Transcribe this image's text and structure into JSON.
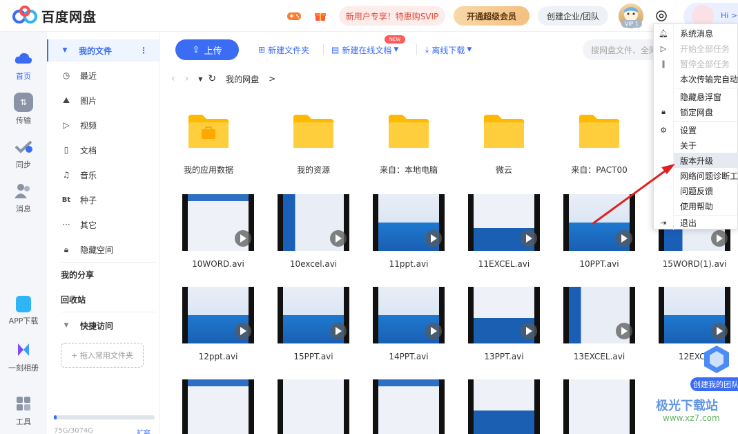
{
  "app": {
    "title": "百度网盘"
  },
  "header": {
    "promo": "新用户专享！特惠购SVIP",
    "svip_button": "开通超级会员",
    "team_button": "创建企业/团队",
    "vip_tag": "VIP 1",
    "hi": "Hi >"
  },
  "leftnav": [
    {
      "label": "首页",
      "icon": "cloud-icon"
    },
    {
      "label": "传输",
      "icon": "transfer-icon"
    },
    {
      "label": "同步",
      "icon": "sync-icon"
    },
    {
      "label": "消息",
      "icon": "message-icon"
    },
    {
      "label": "APP下载",
      "icon": "phone-icon"
    },
    {
      "label": "一刻相册",
      "icon": "album-icon"
    },
    {
      "label": "工具",
      "icon": "tools-icon"
    }
  ],
  "sidebar": {
    "my_files": "我的文件",
    "items": [
      {
        "label": "最近",
        "icon": "clock-icon"
      },
      {
        "label": "图片",
        "icon": "image-icon"
      },
      {
        "label": "视频",
        "icon": "video-icon"
      },
      {
        "label": "文档",
        "icon": "document-icon"
      },
      {
        "label": "音乐",
        "icon": "headphones-icon"
      },
      {
        "label": "种子",
        "icon": "bt-icon"
      },
      {
        "label": "其它",
        "icon": "more-icon"
      },
      {
        "label": "隐藏空间",
        "icon": "lock-icon"
      }
    ],
    "my_share": "我的分享",
    "recycle": "回收站",
    "quick_access": "快捷访问",
    "drop_hint": "+ 拖入常用文件夹",
    "quota": "75G/3074G",
    "expand": "扩容"
  },
  "toolbar": {
    "upload": "上传",
    "new_folder": "新建文件夹",
    "new_doc": "新建在线文档",
    "new_badge": "NEW",
    "offline": "离线下载",
    "search_placeholder": "搜网盘文件、全网"
  },
  "breadcrumb": {
    "root": "我的网盘",
    "sep": ">"
  },
  "folders": [
    {
      "name": "我的应用数据"
    },
    {
      "name": "我的资源"
    },
    {
      "name": "来自：本地电脑"
    },
    {
      "name": "微云"
    },
    {
      "name": "来自：PACT00"
    }
  ],
  "videos": [
    {
      "name": "10WORD.avi"
    },
    {
      "name": "10excel.avi"
    },
    {
      "name": "11ppt.avi"
    },
    {
      "name": "11EXCEL.avi"
    },
    {
      "name": "10PPT.avi"
    },
    {
      "name": "15WORD(1).avi"
    },
    {
      "name": "12ppt.avi"
    },
    {
      "name": "15PPT.avi"
    },
    {
      "name": "14PPT.avi"
    },
    {
      "name": "13PPT.avi"
    },
    {
      "name": "13EXCEL.avi"
    },
    {
      "name": "12EXCE"
    }
  ],
  "menu": {
    "items": [
      {
        "label": "系统消息"
      },
      {
        "label": "开始全部任务"
      },
      {
        "label": "暂停全部任务"
      },
      {
        "label": "本次传输完自动"
      },
      {
        "label": "隐藏悬浮窗"
      },
      {
        "label": "锁定网盘"
      },
      {
        "label": "设置"
      },
      {
        "label": "关于"
      },
      {
        "label": "版本升级"
      },
      {
        "label": "网络问题诊断工"
      },
      {
        "label": "问题反馈"
      },
      {
        "label": "使用帮助"
      },
      {
        "label": "退出"
      }
    ]
  },
  "float": {
    "team": "创建我的团队"
  },
  "watermark": {
    "site": "极光下载站",
    "url": "www.xz7.com"
  },
  "colors": {
    "accent": "#3b6cf4",
    "folder": "#ffc93c",
    "promo_text": "#e04a3a",
    "arrow": "#e02020"
  }
}
